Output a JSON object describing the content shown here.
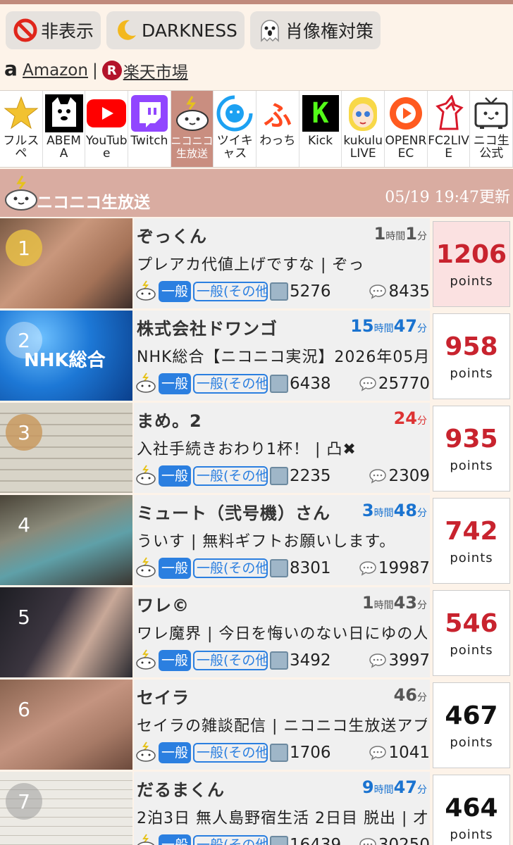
{
  "toolbar": {
    "hide_label": "非表示",
    "darkness_label": "DARKNESS",
    "portrait_label": "肖像権対策"
  },
  "links": {
    "amazon": "Amazon",
    "separator": "|",
    "rakuten": "楽天市場",
    "rakuten_mark": "R"
  },
  "platforms": [
    {
      "label": "フルスペ",
      "icon": "star-icon"
    },
    {
      "label": "ABEMA",
      "icon": "abema-icon"
    },
    {
      "label": "YouTube",
      "icon": "youtube-icon"
    },
    {
      "label": "Twitch",
      "icon": "twitch-icon"
    },
    {
      "label": "ニコニコ生放送",
      "icon": "niconico-icon",
      "selected": true
    },
    {
      "label": "ツイキャス",
      "icon": "twitcasting-icon"
    },
    {
      "label": "わっち",
      "icon": "whowatch-icon",
      "glyph": "ふ"
    },
    {
      "label": "Kick",
      "icon": "kick-icon",
      "glyph": "K"
    },
    {
      "label": "kukuluLIVE",
      "icon": "kukulu-icon"
    },
    {
      "label": "OPENREC",
      "icon": "openrec-icon"
    },
    {
      "label": "FC2LIVE",
      "icon": "fc2-icon"
    },
    {
      "label": "ニコ生公式",
      "icon": "nicolive-official-icon"
    }
  ],
  "category": {
    "title": "ニコニコ生放送",
    "updated": "05/19 19:47更新"
  },
  "points_label": "points",
  "rows": [
    {
      "rank": "1",
      "name": "ぞっくん",
      "dur_h": "1",
      "dur_h_unit": "時間",
      "dur_m": "1",
      "dur_m_unit": "分",
      "dur_color": "gray",
      "title": "プレアカ代値上げですな | ぞっ",
      "tag1": "一般",
      "tag2": "一般(その他)",
      "viewers": "5276",
      "comments": "8435",
      "points": "1206",
      "pts_color": "red"
    },
    {
      "rank": "2",
      "name": "株式会社ドワンゴ",
      "dur_h": "15",
      "dur_h_unit": "時間",
      "dur_m": "47",
      "dur_m_unit": "分",
      "dur_color": "blue",
      "title": "NHK総合【ニコニコ実況】2026年05月",
      "tag1": "一般",
      "tag2": "一般(その他)",
      "viewers": "6438",
      "comments": "25770",
      "points": "958",
      "pts_color": "red",
      "thumb_text": "NHK総合"
    },
    {
      "rank": "3",
      "name": "まめ。2",
      "dur_h": "",
      "dur_h_unit": "",
      "dur_m": "24",
      "dur_m_unit": "分",
      "dur_color": "red",
      "title": "入社手続きおわり1杯！ | 凸✖",
      "tag1": "一般",
      "tag2": "一般(その他)",
      "viewers": "2235",
      "comments": "2309",
      "points": "935",
      "pts_color": "red"
    },
    {
      "rank": "4",
      "name": "ミュート（弐号機）さん",
      "dur_h": "3",
      "dur_h_unit": "時間",
      "dur_m": "48",
      "dur_m_unit": "分",
      "dur_color": "blue",
      "title": "ういす | 無料ギフトお願いします。",
      "tag1": "一般",
      "tag2": "一般(その他)",
      "viewers": "8301",
      "comments": "19987",
      "points": "742",
      "pts_color": "red"
    },
    {
      "rank": "5",
      "name": "ワレ©",
      "dur_h": "1",
      "dur_h_unit": "時間",
      "dur_m": "43",
      "dur_m_unit": "分",
      "dur_color": "gray",
      "title": "ワレ魔界 | 今日を悔いのない日にゆの人",
      "tag1": "一般",
      "tag2": "一般(その他)",
      "viewers": "3492",
      "comments": "3997",
      "points": "546",
      "pts_color": "red"
    },
    {
      "rank": "6",
      "name": "セイラ",
      "dur_h": "",
      "dur_h_unit": "",
      "dur_m": "46",
      "dur_m_unit": "分",
      "dur_color": "gray",
      "title": "セイラの雑談配信 | ニコニコ生放送アプリ",
      "tag1": "一般",
      "tag2": "一般(その他)",
      "viewers": "1706",
      "comments": "1041",
      "points": "467",
      "pts_color": "black"
    },
    {
      "rank": "7",
      "name": "だるまくん",
      "dur_h": "9",
      "dur_h_unit": "時間",
      "dur_m": "47",
      "dur_m_unit": "分",
      "dur_color": "blue",
      "title": "2泊3日 無人島野宿生活 2日目 脱出 | 才",
      "tag1": "一般",
      "tag2": "一般(その他)",
      "viewers": "16439",
      "comments": "30250",
      "points": "464",
      "pts_color": "black"
    }
  ],
  "colors": {
    "accent_blue": "#2b7fe0",
    "points_red": "#c8232e",
    "category_bar": "#d9aca1",
    "selected_platform": "#c98e80"
  }
}
